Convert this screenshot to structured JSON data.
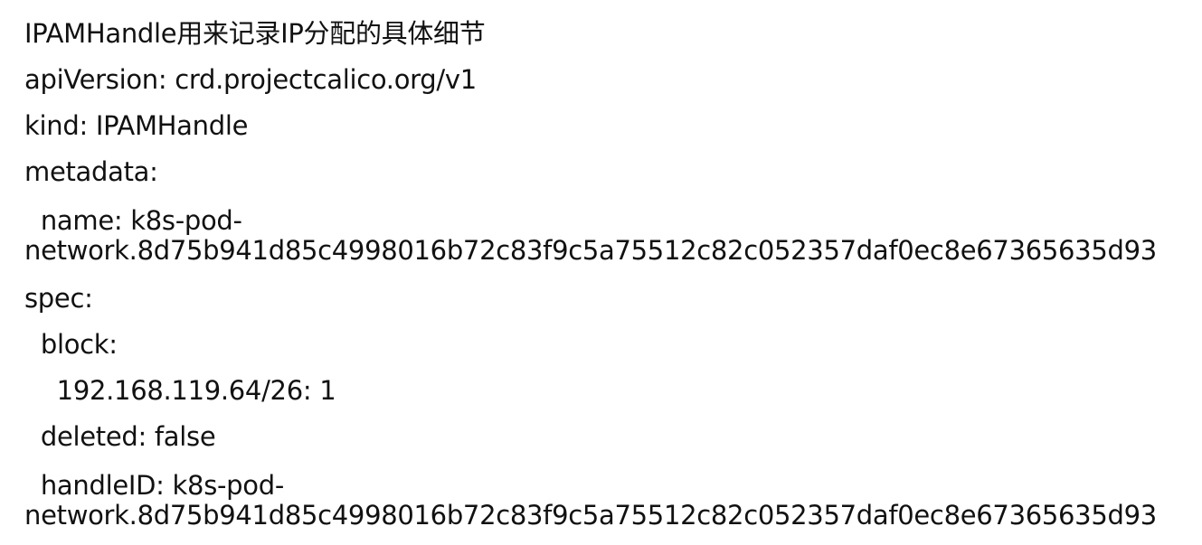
{
  "document": {
    "title": "IPAMHandle用来记录IP分配的具体细节",
    "lines": [
      "apiVersion: crd.projectcalico.org/v1",
      "kind: IPAMHandle",
      "metadata:",
      "  name: k8s-pod-",
      "network.8d75b941d85c4998016b72c83f9c5a75512c82c052357daf0ec8e67365635d93",
      "spec:",
      "  block:",
      "    192.168.119.64/26: 1",
      "  deleted: false",
      "  handleID: k8s-pod-",
      "network.8d75b941d85c4998016b72c83f9c5a75512c82c052357daf0ec8e67365635d93"
    ]
  }
}
